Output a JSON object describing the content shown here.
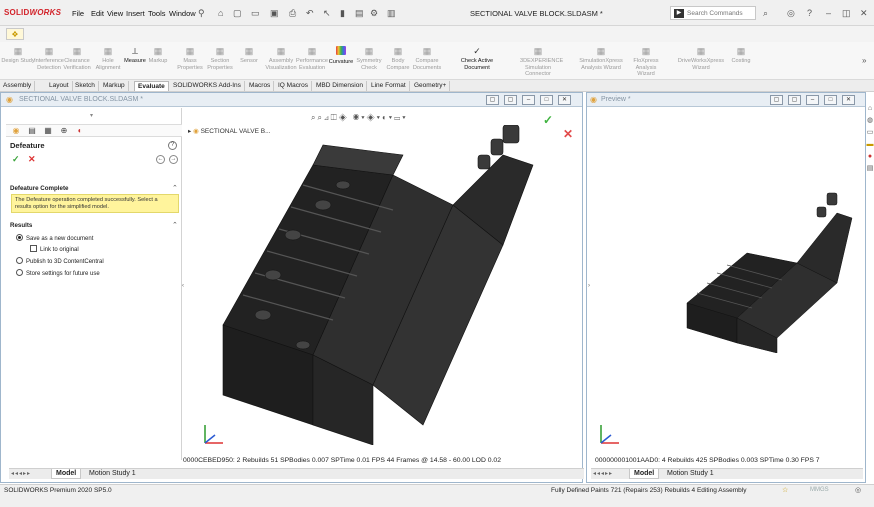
{
  "app": {
    "logo_prefix": "SOLID",
    "logo_suffix": "WORKS",
    "document_title": "SECTIONAL VALVE BLOCK.SLDASM *"
  },
  "menu": [
    "File",
    "Edit",
    "View",
    "Insert",
    "Tools",
    "Window"
  ],
  "search": {
    "placeholder": "Search Commands"
  },
  "ribbon": [
    {
      "l1": "Design Study",
      "l2": "",
      "icon": "design-study-icon",
      "on": false
    },
    {
      "l1": "Interference",
      "l2": "Detection",
      "icon": "interference-icon",
      "on": false
    },
    {
      "l1": "Clearance",
      "l2": "Verification",
      "icon": "clearance-icon",
      "on": false
    },
    {
      "l1": "Hole",
      "l2": "Alignment",
      "icon": "hole-icon",
      "on": false
    },
    {
      "l1": "Measure",
      "l2": "",
      "icon": "measure-icon",
      "on": true
    },
    {
      "l1": "Markup",
      "l2": "",
      "icon": "markup-icon",
      "on": false
    },
    {
      "l1": "Mass",
      "l2": "Properties",
      "icon": "mass-icon",
      "on": false
    },
    {
      "l1": "Section",
      "l2": "Properties",
      "icon": "section-icon",
      "on": false
    },
    {
      "l1": "Sensor",
      "l2": "",
      "icon": "sensor-icon",
      "on": false
    },
    {
      "l1": "Assembly",
      "l2": "Visualization",
      "icon": "assembly-viz-icon",
      "on": false
    },
    {
      "l1": "Performance",
      "l2": "Evaluation",
      "icon": "performance-icon",
      "on": false
    },
    {
      "l1": "Curvature",
      "l2": "",
      "icon": "curvature-icon",
      "on": true
    },
    {
      "l1": "Symmetry",
      "l2": "Check",
      "icon": "symmetry-icon",
      "on": false
    },
    {
      "l1": "Body",
      "l2": "Compare",
      "icon": "body-compare-icon",
      "on": false
    },
    {
      "l1": "Compare",
      "l2": "Documents",
      "icon": "compare-docs-icon",
      "on": false
    },
    {
      "l1": "Check Active Document",
      "l2": "",
      "icon": "check-doc-icon",
      "on": true
    },
    {
      "l1": "3DEXPERIENCE",
      "l2": "Simulation Connector",
      "icon": "3dx-icon",
      "on": false
    },
    {
      "l1": "SimulationXpress",
      "l2": "Analysis Wizard",
      "icon": "simxpress-icon",
      "on": false
    },
    {
      "l1": "FloXpress",
      "l2": "Analysis Wizard",
      "icon": "floxpress-icon",
      "on": false
    },
    {
      "l1": "DriveWorksXpress",
      "l2": "Wizard",
      "icon": "driveworks-icon",
      "on": false
    },
    {
      "l1": "Costing",
      "l2": "",
      "icon": "costing-icon",
      "on": false
    }
  ],
  "tabs": [
    "Assembly",
    "Layout",
    "Sketch",
    "Markup",
    "Evaluate",
    "SOLIDWORKS Add-Ins",
    "Macros",
    "IQ Macros",
    "MBD Dimension",
    "Line Format",
    "Geometry+"
  ],
  "active_tab": "Evaluate",
  "main_window": {
    "title": "SECTIONAL VALVE BLOCK.SLDASM *"
  },
  "property_manager": {
    "feature_title": "Defeature",
    "section_complete": "Defeature Complete",
    "message": "The Defeature operation completed successfully. Select a results option for the simplified model.",
    "section_results": "Results",
    "options": [
      "Save as a new document",
      "Link to original",
      "Publish to 3D ContentCentral",
      "Store settings for future use"
    ]
  },
  "tree_root": "SECTIONAL VALVE B...",
  "status_main": "0000CEBED950:    2 Rebuilds    51 SPBodies  0.007 SPTime    0.01 FPS    44 Frames @  14.58 -  60.00 LOD 0.02",
  "status_preview": "000000001001AAD0:     4 Rebuilds   425 SPBodies  0.003 SPTime    0.30 FPS    7",
  "bottom_tabs": [
    "Model",
    "Motion Study 1"
  ],
  "preview_window": {
    "title": "Preview *"
  },
  "statusbar": {
    "app": "SOLIDWORKS Premium 2020 SP5.0",
    "right": "Fully Defined   Paints 721 (Repairs 253) Rebuilds 4   Editing Assembly",
    "units": "MMGS"
  }
}
